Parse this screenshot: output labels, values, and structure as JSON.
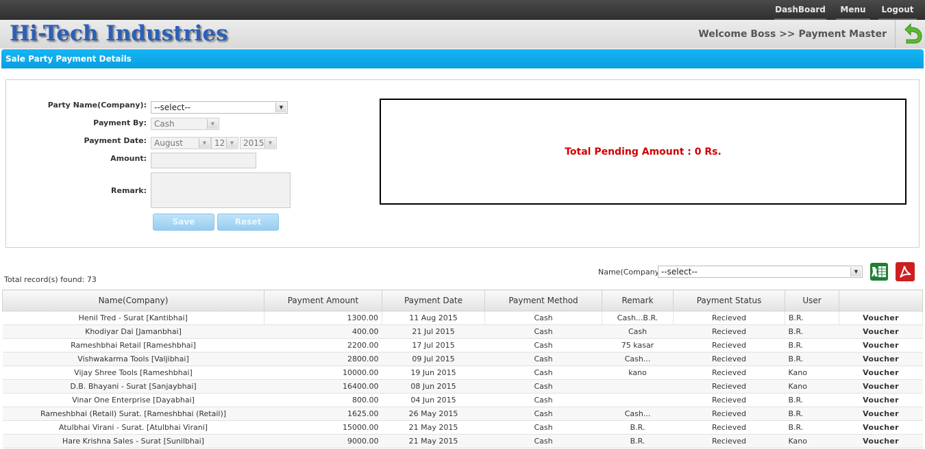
{
  "nav": {
    "dashboard": "DashBoard",
    "menu": "Menu",
    "logout": "Logout"
  },
  "header": {
    "logo": "Hi-Tech Industries",
    "welcome": "Welcome Boss >> Payment Master"
  },
  "section_title": "Sale Party Payment Details",
  "form": {
    "party_label": "Party Name(Company):",
    "party_value": "--select--",
    "payment_by_label": "Payment By:",
    "payment_by_value": "Cash",
    "payment_date_label": "Payment Date:",
    "date_month": "August",
    "date_day": "12",
    "date_year": "2015",
    "amount_label": "Amount:",
    "amount_value": "",
    "remark_label": "Remark:",
    "remark_value": "",
    "save_label": "Save",
    "reset_label": "Reset"
  },
  "pending_text": "Total Pending Amount : 0 Rs.",
  "records": {
    "total_text": "Total record(s) found: 73",
    "filter_label": "Name(Company):",
    "filter_value": "--select--"
  },
  "table": {
    "headers": [
      "Name(Company)",
      "Payment Amount",
      "Payment Date",
      "Payment Method",
      "Remark",
      "Payment Status",
      "User",
      ""
    ],
    "voucher_label": "Voucher",
    "rows": [
      [
        "Henil Tred - Surat [Kantibhai]",
        "1300.00",
        "11 Aug 2015",
        "Cash",
        "Cash...B.R.",
        "Recieved",
        "B.R."
      ],
      [
        "Khodiyar Dai [Jamanbhai]",
        "400.00",
        "21 Jul 2015",
        "Cash",
        "Cash",
        "Recieved",
        "B.R."
      ],
      [
        "Rameshbhai Retail [Rameshbhai]",
        "2200.00",
        "17 Jul 2015",
        "Cash",
        "75 kasar",
        "Recieved",
        "B.R."
      ],
      [
        "Vishwakarma Tools [Valjibhai]",
        "2800.00",
        "09 Jul 2015",
        "Cash",
        "Cash...",
        "Recieved",
        "B.R."
      ],
      [
        "Vijay Shree Tools [Rameshbhai]",
        "10000.00",
        "19 Jun 2015",
        "Cash",
        "kano",
        "Recieved",
        "Kano"
      ],
      [
        "D.B. Bhayani - Surat [Sanjaybhai]",
        "16400.00",
        "08 Jun 2015",
        "Cash",
        "",
        "Recieved",
        "Kano"
      ],
      [
        "Vinar One Enterprise [Dayabhai]",
        "800.00",
        "04 Jun 2015",
        "Cash",
        "",
        "Recieved",
        "B.R."
      ],
      [
        "Rameshbhai (Retail) Surat. [Rameshbhai (Retail)]",
        "1625.00",
        "26 May 2015",
        "Cash",
        "Cash...",
        "Recieved",
        "B.R."
      ],
      [
        "Atulbhai Virani - Surat. [Atulbhai Virani]",
        "15000.00",
        "21 May 2015",
        "Cash",
        "B.R.",
        "Recieved",
        "B.R."
      ],
      [
        "Hare Krishna Sales - Surat [Sunilbhai]",
        "9000.00",
        "21 May 2015",
        "Cash",
        "B.R.",
        "Recieved",
        "Kano"
      ]
    ]
  },
  "icons": {
    "back": "undo-arrow-icon",
    "excel": "excel-export-icon",
    "pdf": "pdf-export-icon"
  },
  "colors": {
    "accent": "#0aa8ec",
    "pending": "#d00000",
    "voucher": "#1a9fdc",
    "logo": "#2c5fb8"
  }
}
